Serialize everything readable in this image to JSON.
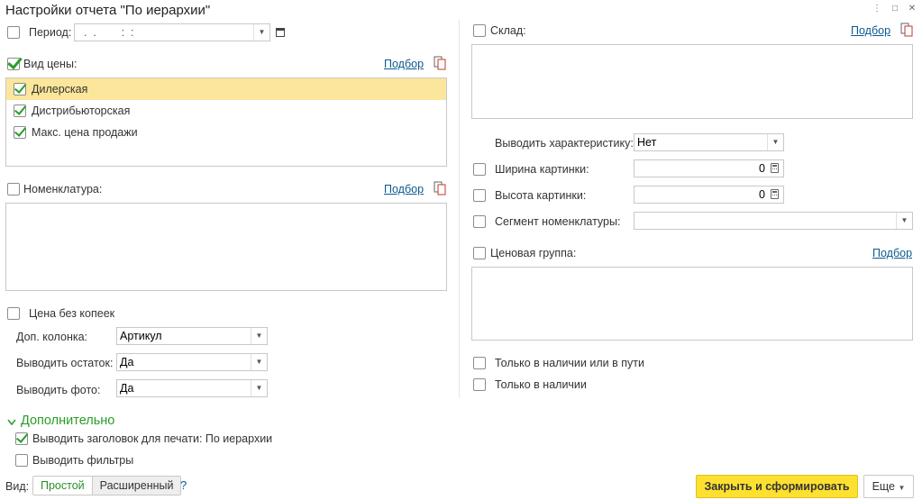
{
  "window": {
    "title": "Настройки отчета \"По иерархии\""
  },
  "left": {
    "period": {
      "label": "Период:",
      "value": "  .  .        :  :"
    },
    "price_type": {
      "label": "Вид цены:",
      "pick_link": "Подбор",
      "items": [
        {
          "label": "Дилерская",
          "checked": true,
          "selected": true
        },
        {
          "label": "Дистрибьюторская",
          "checked": true,
          "selected": false
        },
        {
          "label": "Макс. цена продажи",
          "checked": true,
          "selected": false
        }
      ]
    },
    "nomenclature": {
      "label": "Номенклатура:",
      "pick_link": "Подбор"
    },
    "no_kopecks": {
      "label": "Цена без копеек"
    },
    "extra_column": {
      "label": "Доп. колонка:",
      "value": "Артикул"
    },
    "show_stock": {
      "label": "Выводить остаток:",
      "value": "Да"
    },
    "show_photo": {
      "label": "Выводить фото:",
      "value": "Да"
    }
  },
  "right": {
    "warehouse": {
      "label": "Склад:",
      "pick_link": "Подбор"
    },
    "show_characteristic": {
      "label": "Выводить характеристику:",
      "value": "Нет"
    },
    "image_width": {
      "label": "Ширина картинки:",
      "value": "0"
    },
    "image_height": {
      "label": "Высота картинки:",
      "value": "0"
    },
    "segment": {
      "label": "Сегмент номенклатуры:",
      "value": ""
    },
    "price_group": {
      "label": "Ценовая группа:",
      "pick_link": "Подбор"
    },
    "in_stock_or_transit": {
      "label": "Только в наличии или в пути"
    },
    "in_stock": {
      "label": "Только в наличии"
    }
  },
  "additional": {
    "title": "Дополнительно",
    "print_header": {
      "label": "Выводить заголовок для печати: По иерархии"
    },
    "show_filters": {
      "label": "Выводить фильтры"
    }
  },
  "footer": {
    "view_label": "Вид:",
    "simple": "Простой",
    "extended": "Расширенный",
    "help": "?",
    "close_and_build": "Закрыть и сформировать",
    "more": "Еще"
  },
  "colors": {
    "accent": "#2a9d2a",
    "primary_button": "#fde030",
    "selected_row": "#fbe69b",
    "link": "#0b5a8f"
  }
}
